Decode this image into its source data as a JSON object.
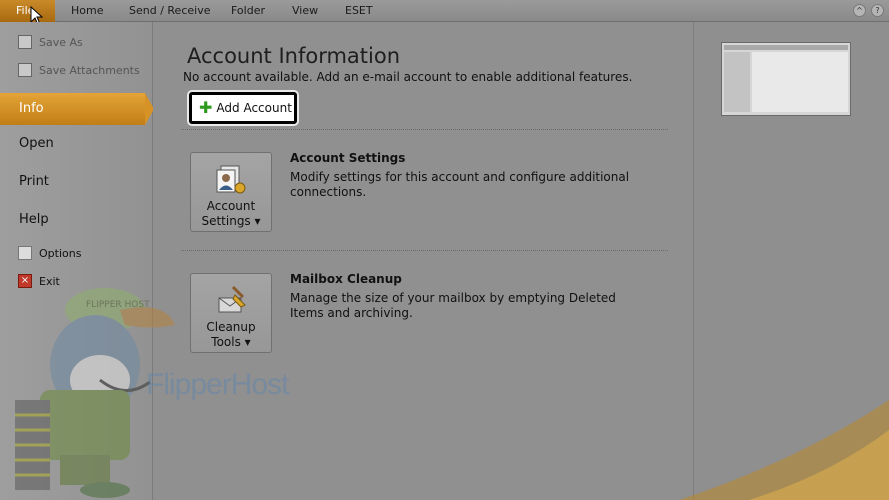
{
  "ribbon": {
    "file_tab": "File",
    "tabs": [
      "Home",
      "Send / Receive",
      "Folder",
      "View",
      "ESET"
    ]
  },
  "nav": {
    "save_as": "Save As",
    "save_attachments": "Save Attachments",
    "info": "Info",
    "open": "Open",
    "print": "Print",
    "help": "Help",
    "options": "Options",
    "exit": "Exit"
  },
  "main": {
    "title": "Account Information",
    "subtitle": "No account available. Add an e-mail account to enable additional features.",
    "add_account": "Add Account",
    "account_settings": {
      "button_line1": "Account",
      "button_line2": "Settings ▾",
      "title": "Account Settings",
      "description": "Modify settings for this account and configure additional connections."
    },
    "mailbox_cleanup": {
      "button_line1": "Cleanup",
      "button_line2": "Tools ▾",
      "title": "Mailbox Cleanup",
      "description": "Manage the size of your mailbox by emptying Deleted Items and archiving."
    }
  },
  "watermark": {
    "mascot_cap": "FLIPPER HOST",
    "logo_text": "FlipperHost"
  },
  "colors": {
    "accent": "#d79226",
    "add_icon": "#2e9b1f"
  }
}
